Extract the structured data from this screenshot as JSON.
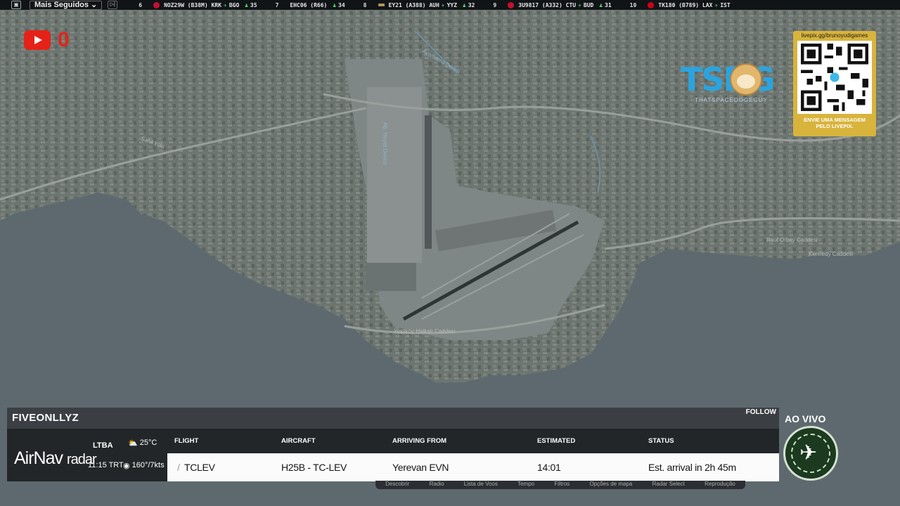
{
  "topbar": {
    "select_label": "Mais Seguidos",
    "ticker": [
      {
        "rank": "6",
        "flight": "NOZ29W (B38M)",
        "from": "KRK",
        "to": "BGO",
        "count": "35",
        "logo_color": "#c8102e"
      },
      {
        "rank": "7",
        "flight": "EHC06 (R66)",
        "from": "",
        "to": "",
        "count": "34",
        "logo_color": ""
      },
      {
        "rank": "8",
        "flight": "EY21 (A388)",
        "from": "AUH",
        "to": "YYZ",
        "count": "32",
        "logo_color": "#b0955a"
      },
      {
        "rank": "9",
        "flight": "3U9817 (A332)",
        "from": "CTU",
        "to": "BUD",
        "count": "31",
        "logo_color": "#c8102e"
      },
      {
        "rank": "10",
        "flight": "TK180 (B789)",
        "from": "LAX",
        "to": "IST",
        "count": "",
        "logo_color": "#d0021b"
      }
    ]
  },
  "youtube": {
    "count": "0"
  },
  "tsdg": {
    "logo_text": "TSDG",
    "subtitle": "THATSPACEDOGEGUY"
  },
  "qr": {
    "url": "livepix.gg/brunoyudigames",
    "caption_line1": "ENVIE UMA MENSAGEM",
    "caption_line2": "PELO LIVEPIX."
  },
  "map_labels": [
    "Ayamama Deresi",
    "Ab. Hayat Deresi",
    "Sahil Yolu",
    "Yeşilköy Halkalı Caddesi",
    "Rauf Orbay Caddesi",
    "Kennedy Caddesi"
  ],
  "panel": {
    "title": "FIVEONLLYZ",
    "follow": "FOLLOW",
    "brand_main": "AirNav",
    "brand_sub": "radar",
    "airport_code": "LTBA",
    "local_time": "11:15 TRT",
    "temperature": "25°C",
    "wind": "160°/7kts",
    "headers": {
      "flight": "FLIGHT",
      "aircraft": "AIRCRAFT",
      "arriving_from": "ARRIVING FROM",
      "estimated": "ESTIMATED",
      "status": "STATUS"
    },
    "row": {
      "flight": "TCLEV",
      "aircraft": "H25B - TC-LEV",
      "arriving_from": "Yerevan EVN",
      "estimated": "14:01",
      "status": "Est. arrival in 2h 45m"
    }
  },
  "toolbar": [
    "Descobrir",
    "Radio",
    "Lista de Voos",
    "Tempo",
    "Filtros",
    "Opções de mapa",
    "Radar Select",
    "Reprodução"
  ],
  "live": {
    "label": "AO VIVO"
  },
  "colors": {
    "accent_blue": "#2aa4e0",
    "youtube_red": "#e62117",
    "qr_gold": "#d8b43c",
    "arrow_green": "#4cd964"
  }
}
